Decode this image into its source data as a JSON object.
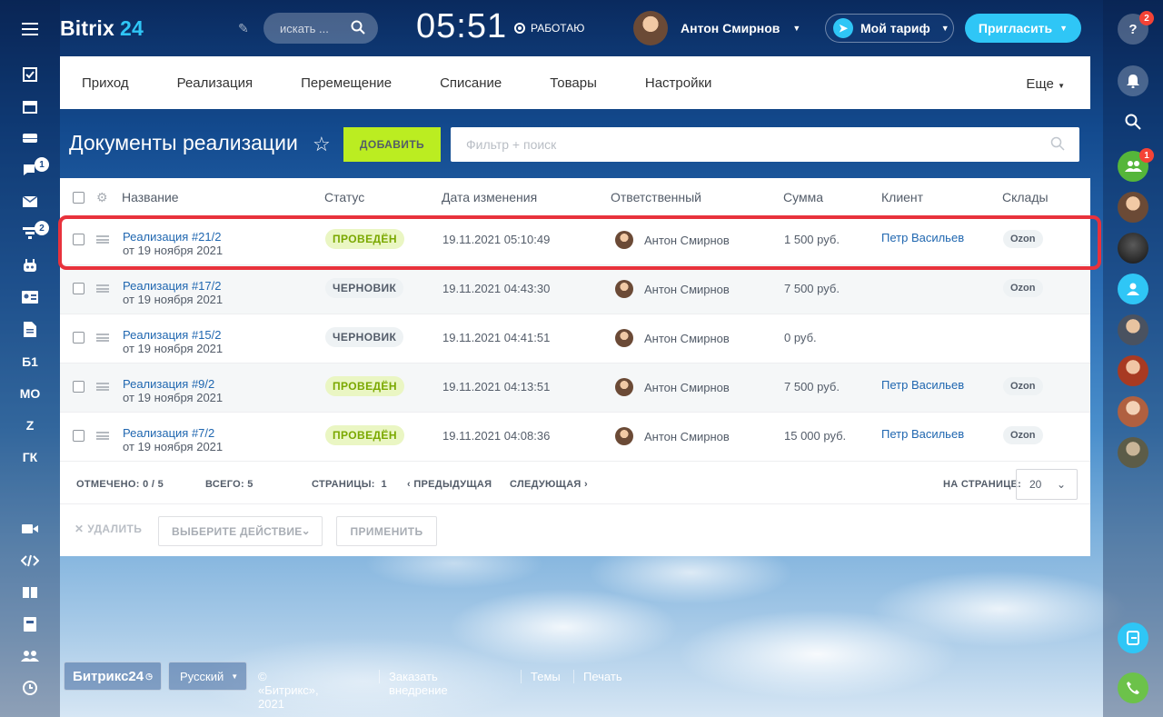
{
  "app": {
    "brand": "Bitrix",
    "brand_num": "24",
    "clock": "05:51",
    "work_status": "РАБОТАЮ",
    "search_placeholder": "искать ..."
  },
  "user": {
    "name": "Антон Смирнов"
  },
  "header": {
    "tariff_label": "Мой тариф",
    "invite_label": "Пригласить"
  },
  "left_menu": {
    "badges": {
      "chat": "1",
      "feed": "2"
    },
    "text_items": [
      "Б1",
      "МО",
      "Z",
      "ГК"
    ]
  },
  "right_menu": {
    "help_badge": "2",
    "team_badge": "1"
  },
  "nav": {
    "tabs": [
      "Приход",
      "Реализация",
      "Перемещение",
      "Списание",
      "Товары",
      "Настройки"
    ],
    "more": "Еще"
  },
  "page": {
    "title": "Документы реализации",
    "add_button": "ДОБАВИТЬ",
    "filter_placeholder": "Фильтр + поиск"
  },
  "table": {
    "columns": [
      "Название",
      "Статус",
      "Дата изменения",
      "Ответственный",
      "Сумма",
      "Клиент",
      "Склады"
    ],
    "rows": [
      {
        "name": "Реализация #21/2",
        "date_sub": "от 19 ноября 2021",
        "status": "ПРОВЕДЁН",
        "status_type": "done",
        "modified": "19.11.2021 05:10:49",
        "responsible": "Антон Смирнов",
        "sum": "1 500 руб.",
        "client": "Петр Васильев",
        "store": "Ozon"
      },
      {
        "name": "Реализация #17/2",
        "date_sub": "от 19 ноября 2021",
        "status": "ЧЕРНОВИК",
        "status_type": "draft",
        "modified": "19.11.2021 04:43:30",
        "responsible": "Антон Смирнов",
        "sum": "7 500 руб.",
        "client": "",
        "store": "Ozon"
      },
      {
        "name": "Реализация #15/2",
        "date_sub": "от 19 ноября 2021",
        "status": "ЧЕРНОВИК",
        "status_type": "draft",
        "modified": "19.11.2021 04:41:51",
        "responsible": "Антон Смирнов",
        "sum": "0 руб.",
        "client": "",
        "store": ""
      },
      {
        "name": "Реализация #9/2",
        "date_sub": "от 19 ноября 2021",
        "status": "ПРОВЕДЁН",
        "status_type": "done",
        "modified": "19.11.2021 04:13:51",
        "responsible": "Антон Смирнов",
        "sum": "7 500 руб.",
        "client": "Петр Васильев",
        "store": "Ozon"
      },
      {
        "name": "Реализация #7/2",
        "date_sub": "от 19 ноября 2021",
        "status": "ПРОВЕДЁН",
        "status_type": "done",
        "modified": "19.11.2021 04:08:36",
        "responsible": "Антон Смирнов",
        "sum": "15 000 руб.",
        "client": "Петр Васильев",
        "store": "Ozon"
      }
    ]
  },
  "pager": {
    "selected_label": "ОТМЕЧЕНО:",
    "selected_value": "0 / 5",
    "total_label": "ВСЕГО:",
    "total_value": "5",
    "pages_label": "СТРАНИЦЫ:",
    "pages_value": "1",
    "prev": "ПРЕДЫДУЩАЯ",
    "next": "СЛЕДУЮЩАЯ",
    "per_page_label": "НА СТРАНИЦЕ:",
    "per_page_value": "20"
  },
  "actions": {
    "delete": "УДАЛИТЬ",
    "select_action": "ВЫБЕРИТЕ ДЕЙСТВИЕ",
    "apply": "ПРИМЕНИТЬ"
  },
  "footer": {
    "logo": "Битрикс24",
    "language": "Русский",
    "copyright": "© «Битрикс», 2021",
    "links": [
      "Заказать внедрение",
      "Темы",
      "Печать"
    ]
  }
}
